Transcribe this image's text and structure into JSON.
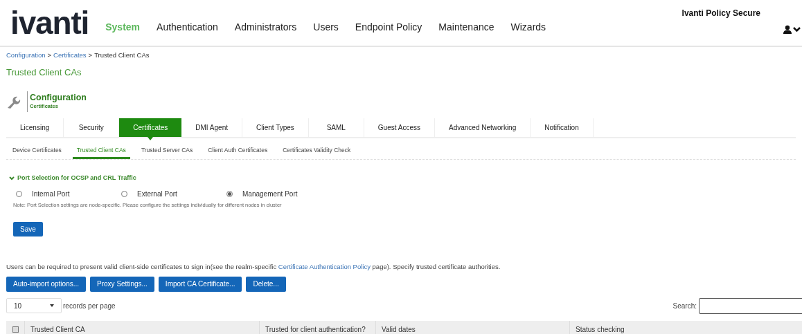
{
  "header": {
    "logo": "ivanti",
    "product": "Ivanti Policy Secure",
    "nav": [
      {
        "label": "System",
        "selected": true
      },
      {
        "label": "Authentication",
        "selected": false
      },
      {
        "label": "Administrators",
        "selected": false
      },
      {
        "label": "Users",
        "selected": false
      },
      {
        "label": "Endpoint Policy",
        "selected": false
      },
      {
        "label": "Maintenance",
        "selected": false
      },
      {
        "label": "Wizards",
        "selected": false
      }
    ]
  },
  "breadcrumb": [
    {
      "label": "Configuration",
      "kind": "link"
    },
    {
      "label": ">",
      "kind": "separator"
    },
    {
      "label": "Certificates",
      "kind": "link"
    },
    {
      "label": ">",
      "kind": "separator"
    },
    {
      "label": "Trusted Client CAs",
      "kind": "current"
    }
  ],
  "page_title": "Trusted Client CAs",
  "section": {
    "title": "Configuration",
    "subtitle": "Certificates"
  },
  "tabs": [
    {
      "label": "Licensing",
      "selected": false
    },
    {
      "label": "Security",
      "selected": false
    },
    {
      "label": "Certificates",
      "selected": true
    },
    {
      "label": "DMI Agent",
      "selected": false
    },
    {
      "label": "Client Types",
      "selected": false
    },
    {
      "label": "SAML",
      "selected": false
    },
    {
      "label": "Guest Access",
      "selected": false
    },
    {
      "label": "Advanced Networking",
      "selected": false
    },
    {
      "label": "Notification",
      "selected": false
    }
  ],
  "subtabs": [
    {
      "label": "Device Certificates",
      "selected": false
    },
    {
      "label": "Trusted Client CAs",
      "selected": true
    },
    {
      "label": "Trusted Server CAs",
      "selected": false
    },
    {
      "label": "Client Auth Certificates",
      "selected": false
    },
    {
      "label": "Certificates Validity Check",
      "selected": false
    }
  ],
  "port_selection": {
    "title": "Port Selection for OCSP and CRL Traffic",
    "expanded": true,
    "options": [
      {
        "label": "Internal Port",
        "selected": false
      },
      {
        "label": "External Port",
        "selected": false
      },
      {
        "label": "Management Port",
        "selected": true
      }
    ],
    "note": "Note: Port Selection settings are node-specific. Please configure the settings individually for different nodes in cluster",
    "save": "Save"
  },
  "description": {
    "before": "Users can be required to present valid client-side certificates to sign in(see the realm-specific ",
    "link": "Certificate Authentication Policy",
    "after": " page). Specify trusted certificate authorities."
  },
  "actions": [
    "Auto-import options...",
    "Proxy Settings...",
    "Import CA Certificate...",
    "Delete..."
  ],
  "records": {
    "value": "10",
    "label": "records per page"
  },
  "search": {
    "label": "Search:"
  },
  "table": {
    "select_all": {
      "checked": false
    },
    "columns": [
      "Trusted Client CA",
      "Trusted for client authentication?",
      "Valid dates",
      "Status checking"
    ]
  }
}
